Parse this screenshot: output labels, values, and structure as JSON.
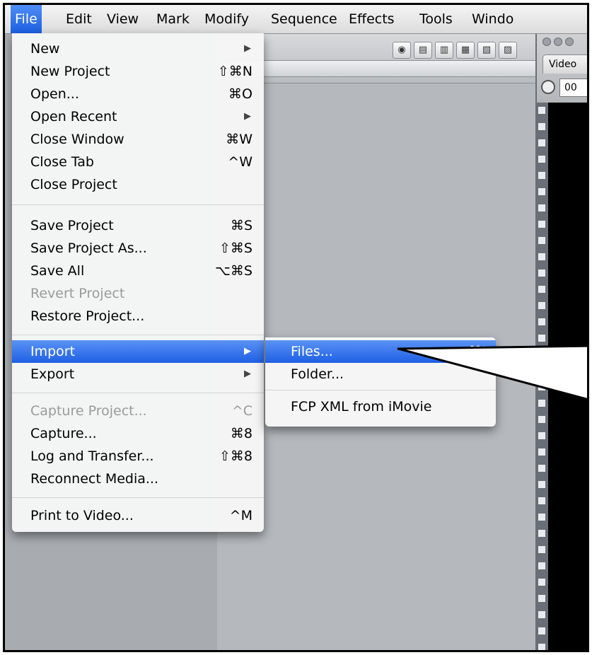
{
  "menubar": {
    "items": [
      "File",
      "Edit",
      "View",
      "Mark",
      "Modify",
      "Sequence",
      "Effects",
      "Tools",
      "Windo"
    ]
  },
  "file_menu": {
    "new": {
      "label": "New"
    },
    "new_project": {
      "label": "New Project",
      "shortcut": "⇧⌘N"
    },
    "open": {
      "label": "Open...",
      "shortcut": "⌘O"
    },
    "open_recent": {
      "label": "Open Recent"
    },
    "close_window": {
      "label": "Close Window",
      "shortcut": "⌘W"
    },
    "close_tab": {
      "label": "Close Tab",
      "shortcut": "^W"
    },
    "close_project": {
      "label": "Close Project"
    },
    "save_project": {
      "label": "Save Project",
      "shortcut": "⌘S"
    },
    "save_project_as": {
      "label": "Save Project As...",
      "shortcut": "⇧⌘S"
    },
    "save_all": {
      "label": "Save All",
      "shortcut": "⌥⌘S"
    },
    "revert_project": {
      "label": "Revert Project"
    },
    "restore_project": {
      "label": "Restore Project..."
    },
    "import": {
      "label": "Import"
    },
    "export": {
      "label": "Export"
    },
    "capture_project": {
      "label": "Capture Project...",
      "shortcut": "^C"
    },
    "capture": {
      "label": "Capture...",
      "shortcut": "⌘8"
    },
    "log_and_transfer": {
      "label": "Log and Transfer...",
      "shortcut": "⇧⌘8"
    },
    "reconnect_media": {
      "label": "Reconnect Media..."
    },
    "print_to_video": {
      "label": "Print to Video...",
      "shortcut": "^M"
    }
  },
  "import_submenu": {
    "files": {
      "label": "Files...",
      "shortcut": "⌘I"
    },
    "folder": {
      "label": "Folder..."
    },
    "fcp_xml": {
      "label": "FCP XML from iMovie"
    }
  },
  "viewer": {
    "tab_label": "Video",
    "timecode": "00"
  },
  "colors": {
    "highlight": "#2a6ae8",
    "menu_bg": "#f6f6f6",
    "disabled_text": "#9a9a9a"
  }
}
